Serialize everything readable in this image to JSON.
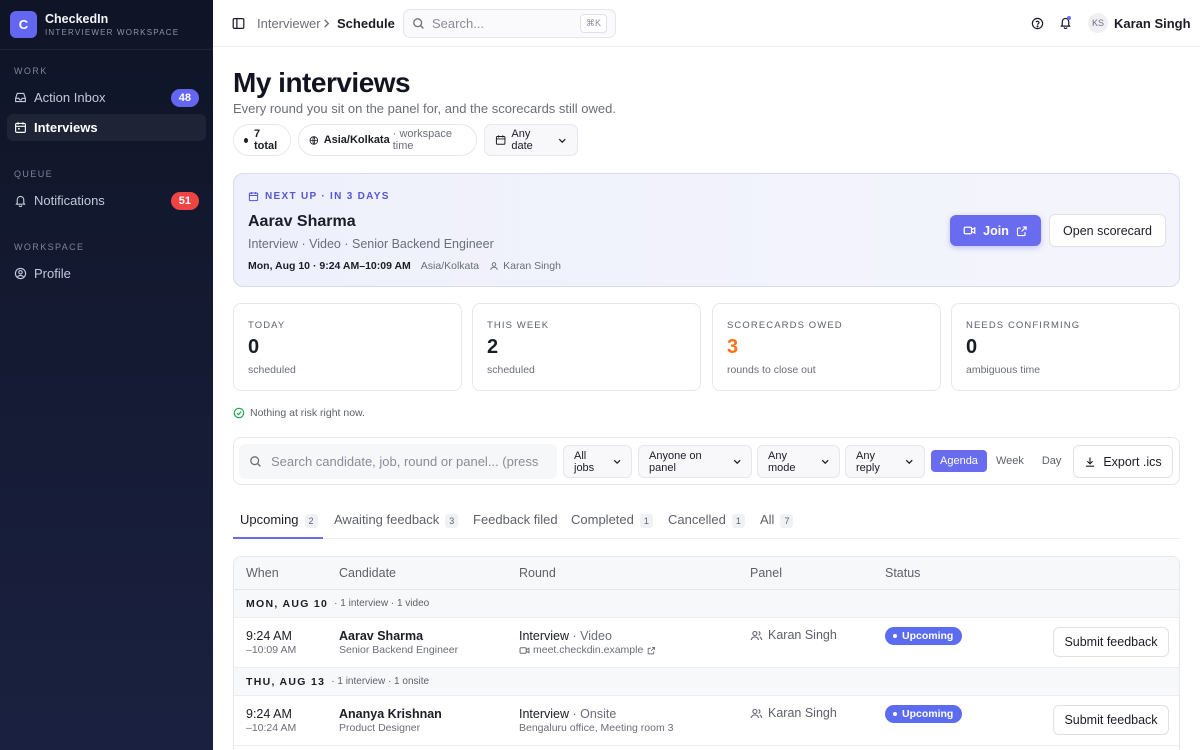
{
  "brand": {
    "logo_letter": "C",
    "name": "CheckedIn",
    "subtitle": "INTERVIEWER WORKSPACE"
  },
  "sidebar": {
    "sections": [
      {
        "title": "WORK",
        "items": [
          {
            "label": "Action Inbox",
            "icon": "inbox-icon",
            "badge": "48"
          },
          {
            "label": "Interviews",
            "icon": "calendar-icon",
            "active": true
          }
        ]
      },
      {
        "title": "QUEUE",
        "items": [
          {
            "label": "Notifications",
            "icon": "bell-icon",
            "badge": "51"
          }
        ]
      },
      {
        "title": "WORKSPACE",
        "items": [
          {
            "label": "Profile",
            "icon": "user-circle-icon"
          }
        ]
      }
    ],
    "badge_colors": {
      "inbox": "#6366f1",
      "notifications": "#ef4444"
    }
  },
  "topbar": {
    "breadcrumb": [
      "Interviewer",
      "Schedule"
    ],
    "search_placeholder": "Search...",
    "search_shortcut": "⌘K",
    "user": {
      "initials": "KS",
      "name": "Karan Singh"
    }
  },
  "page": {
    "title": "My interviews",
    "subtitle": "Every round you sit on the panel for, and the scorecards still owed.",
    "chips": {
      "total": "7 total",
      "timezone": "Asia/Kolkata",
      "timezone_note": "· workspace time",
      "date_filter": "Any date"
    }
  },
  "next_up": {
    "kicker": "NEXT UP · IN 3 DAYS",
    "candidate": "Aarav Sharma",
    "meta": "Interview · Video · Senior Backend Engineer",
    "time": "Mon, Aug 10 · 9:24 AM–10:09 AM",
    "timezone": "Asia/Kolkata",
    "interviewer": "Karan Singh",
    "join_label": "Join",
    "scorecard_label": "Open scorecard"
  },
  "stats": [
    {
      "label": "TODAY",
      "value": "0",
      "sub": "scheduled"
    },
    {
      "label": "THIS WEEK",
      "value": "2",
      "sub": "scheduled"
    },
    {
      "label": "SCORECARDS OWED",
      "value": "3",
      "sub": "rounds to close out",
      "accent": "#f97316"
    },
    {
      "label": "NEEDS CONFIRMING",
      "value": "0",
      "sub": "ambiguous time"
    }
  ],
  "risk_note": "Nothing at risk right now.",
  "filters": {
    "search_placeholder": "Search candidate, job, round or panel... (press",
    "jobs": "All jobs",
    "panel": "Anyone on panel",
    "mode": "Any mode",
    "reply": "Any reply",
    "views": [
      "Agenda",
      "Week",
      "Day"
    ],
    "active_view": "Agenda",
    "export_label": "Export .ics"
  },
  "tabs": [
    {
      "label": "Upcoming",
      "count": "2",
      "active": true
    },
    {
      "label": "Awaiting feedback",
      "count": "3"
    },
    {
      "label": "Feedback filed"
    },
    {
      "label": "Completed",
      "count": "1"
    },
    {
      "label": "Cancelled",
      "count": "1"
    },
    {
      "label": "All",
      "count": "7"
    }
  ],
  "table": {
    "columns": [
      "When",
      "Candidate",
      "Round",
      "Panel",
      "Status"
    ],
    "groups": [
      {
        "date": "MON, AUG 10",
        "summary": "· 1 interview · 1 video",
        "rows": [
          {
            "start": "9:24 AM",
            "end": "–10:09 AM",
            "candidate": "Aarav Sharma",
            "role": "Senior Backend Engineer",
            "round_type": "Interview",
            "round_mode": "· Video",
            "location": "meet.checkdin.example",
            "panel": "Karan Singh",
            "status": "Upcoming",
            "action": "Submit feedback"
          }
        ]
      },
      {
        "date": "THU, AUG 13",
        "summary": "· 1 interview · 1 onsite",
        "rows": [
          {
            "start": "9:24 AM",
            "end": "–10:24 AM",
            "candidate": "Ananya Krishnan",
            "role": "Product Designer",
            "round_type": "Interview",
            "round_mode": "· Onsite",
            "location": "Bengaluru office, Meeting room 3",
            "panel": "Karan Singh",
            "status": "Upcoming",
            "action": "Submit feedback"
          }
        ]
      }
    ]
  }
}
